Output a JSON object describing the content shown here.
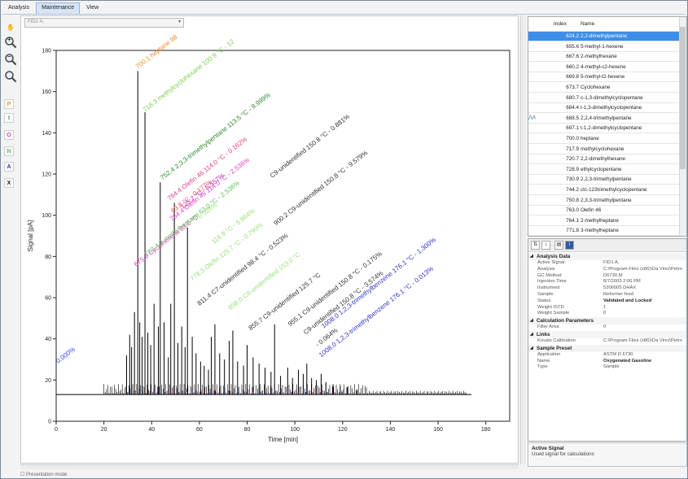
{
  "tabs": [
    {
      "label": "Analysis",
      "active": false
    },
    {
      "label": "Maintenance",
      "active": true
    },
    {
      "label": "View",
      "active": false
    }
  ],
  "toolbar": {
    "tools": [
      {
        "name": "pan-hand-icon",
        "glyph": "✋",
        "color": "#e8a020"
      },
      {
        "name": "zoom-in-icon",
        "glyph": "+",
        "color": "#333"
      },
      {
        "name": "zoom-out-icon",
        "glyph": "−",
        "color": "#333"
      },
      {
        "name": "zoom-reset-icon",
        "glyph": "",
        "color": "#333"
      },
      {
        "name": "paraffins-filter-icon",
        "glyph": "P",
        "color": "#e8a020"
      },
      {
        "name": "isoparaffins-filter-icon",
        "glyph": "I",
        "color": "#3a9a3a"
      },
      {
        "name": "olefins-filter-icon",
        "glyph": "O",
        "color": "#e040c0"
      },
      {
        "name": "naphthenes-filter-icon",
        "glyph": "N",
        "color": "#60c060"
      },
      {
        "name": "aromatics-filter-icon",
        "glyph": "A",
        "color": "#2a3ad0"
      },
      {
        "name": "unknowns-filter-icon",
        "glyph": "X",
        "color": "#222"
      }
    ]
  },
  "signal_select": {
    "value": "FID1 A,"
  },
  "bottom_text": "Presentation mode",
  "chart_data": {
    "type": "line",
    "xlabel": "Time [min]",
    "ylabel": "Signal [pA]",
    "xlim": [
      0,
      190
    ],
    "ylim": [
      0,
      180
    ],
    "xticks": [
      0,
      20,
      40,
      60,
      80,
      100,
      120,
      140,
      160,
      180
    ],
    "yticks": [
      0,
      20,
      40,
      60,
      80,
      100,
      120,
      140,
      160,
      180
    ],
    "baseline": 13,
    "trace_end_x": 174,
    "peaks": [
      {
        "x": 29.5,
        "h": 32
      },
      {
        "x": 30.8,
        "h": 42
      },
      {
        "x": 31.6,
        "h": 36
      },
      {
        "x": 32.8,
        "h": 53
      },
      {
        "x": 34.2,
        "h": 170
      },
      {
        "x": 35.0,
        "h": 48
      },
      {
        "x": 36.0,
        "h": 41
      },
      {
        "x": 37.2,
        "h": 150
      },
      {
        "x": 38.4,
        "h": 43
      },
      {
        "x": 39.6,
        "h": 37
      },
      {
        "x": 41.0,
        "h": 57
      },
      {
        "x": 42.8,
        "h": 46
      },
      {
        "x": 43.6,
        "h": 116
      },
      {
        "x": 45.2,
        "h": 48
      },
      {
        "x": 47.0,
        "h": 31
      },
      {
        "x": 48.0,
        "h": 57
      },
      {
        "x": 49.5,
        "h": 106
      },
      {
        "x": 51.0,
        "h": 38
      },
      {
        "x": 52.6,
        "h": 46
      },
      {
        "x": 54.0,
        "h": 36
      },
      {
        "x": 55.0,
        "h": 94
      },
      {
        "x": 57.0,
        "h": 41
      },
      {
        "x": 58.6,
        "h": 33
      },
      {
        "x": 60.5,
        "h": 29
      },
      {
        "x": 62.0,
        "h": 27
      },
      {
        "x": 63.8,
        "h": 25
      },
      {
        "x": 65.0,
        "h": 41
      },
      {
        "x": 66.5,
        "h": 47
      },
      {
        "x": 68.5,
        "h": 33
      },
      {
        "x": 70.5,
        "h": 30
      },
      {
        "x": 72.5,
        "h": 39
      },
      {
        "x": 74.0,
        "h": 44
      },
      {
        "x": 76.0,
        "h": 29
      },
      {
        "x": 78.5,
        "h": 27
      },
      {
        "x": 80.0,
        "h": 37
      },
      {
        "x": 82.5,
        "h": 31
      },
      {
        "x": 85.0,
        "h": 28
      },
      {
        "x": 87.5,
        "h": 26
      },
      {
        "x": 90.0,
        "h": 24
      },
      {
        "x": 91.5,
        "h": 47
      },
      {
        "x": 94.0,
        "h": 22
      },
      {
        "x": 97.0,
        "h": 26
      },
      {
        "x": 99.0,
        "h": 21
      },
      {
        "x": 101.5,
        "h": 25
      },
      {
        "x": 103.5,
        "h": 23
      },
      {
        "x": 105.0,
        "h": 28
      },
      {
        "x": 107.0,
        "h": 21
      },
      {
        "x": 109.0,
        "h": 20
      },
      {
        "x": 111.0,
        "h": 23
      },
      {
        "x": 113.0,
        "h": 19
      },
      {
        "x": 116.0,
        "h": 18
      },
      {
        "x": 119.0,
        "h": 17
      },
      {
        "x": 122.0,
        "h": 16.5
      },
      {
        "x": 126.0,
        "h": 15.5
      }
    ],
    "annotations": [
      {
        "x": 34.2,
        "y": 171,
        "text": "700.1 heptane 98",
        "color": "#f08a20"
      },
      {
        "x": 37.2,
        "y": 150,
        "text": "718.3 methylcyclohexane 100.9 °C - 12",
        "color": "#7ad04a"
      },
      {
        "x": 44.5,
        "y": 117,
        "text": "752.4 2,3,3-trimethylpentane 113.5 °C - 9.999%",
        "color": "#2a8a2a"
      },
      {
        "x": 47.5,
        "y": 107,
        "text": "764.4 Olefin 46 114.0 °C - 0.162%",
        "color": "#e83a8a"
      },
      {
        "x": 49.0,
        "y": 101,
        "text": "63.8 °C - 0.177%",
        "color": "#ff5050"
      },
      {
        "x": 53.0,
        "y": 103,
        "text": "125.7 °C - 6.557%",
        "color": "#c030c0"
      },
      {
        "x": 33.5,
        "y": 75,
        "text": "675.8 Cyclohexene 83.0 °C",
        "color": "#e040c0"
      },
      {
        "x": 48.5,
        "y": 97,
        "text": "764.4 Olefin 46 114.0 °C - 2.536%",
        "color": "#e040c0"
      },
      {
        "x": 59.0,
        "y": 97,
        "text": "- 0.026%",
        "color": "#9ae07a"
      },
      {
        "x": 66.0,
        "y": 86,
        "text": "116.9 °C - 5.864%",
        "color": "#9ae07a"
      },
      {
        "x": 90.5,
        "y": 118,
        "text": "C9-unidentified 150.8 °C - 0.881%",
        "color": "#333333"
      },
      {
        "x": 92.0,
        "y": 95,
        "text": "900.2 C9-unidentified 150.8 °C - 9.579%",
        "color": "#333333"
      },
      {
        "x": 38.0,
        "y": 80,
        "text": "763.4 2-methylheptane 63.0 °C - 2.536%",
        "color": "#60c060"
      },
      {
        "x": 57.0,
        "y": 68,
        "text": "778.3 Olefin 125.7 °C - 0.790%",
        "color": "#9ae07a"
      },
      {
        "x": 60.0,
        "y": 56,
        "text": "811.4 C7-unidentified 98.4 °C - 0.523%",
        "color": "#333333"
      },
      {
        "x": 73.0,
        "y": 54,
        "text": "898.0 C9-unidentified 153.0 °C",
        "color": "#9ae07a"
      },
      {
        "x": 81.5,
        "y": 44,
        "text": "855.7 C9-unidentified 125.7 °C",
        "color": "#333333"
      },
      {
        "x": 98.0,
        "y": 46,
        "text": "955.1 C9-unidentified 150.8 °C - 0.175%",
        "color": "#333333"
      },
      {
        "x": 104.5,
        "y": 42,
        "text": "C9-unidentified 150.8 °C - 3.574%",
        "color": "#333333"
      },
      {
        "x": 109.5,
        "y": 36,
        "text": "- 0.064%",
        "color": "#333333"
      },
      {
        "x": 112.0,
        "y": 45,
        "text": "1008.0 1,2,3-trimethylbenzene 176.1 °C - 1.300%",
        "color": "#3030d0"
      },
      {
        "x": 111.0,
        "y": 31,
        "text": "1008.0 1,2,3-trimethylbenzene 176.1 °C - 0.013%",
        "color": "#3030d0"
      },
      {
        "x": 0.8,
        "y": 28,
        "text": "0.000%",
        "color": "#4040ff"
      }
    ],
    "colors": {
      "trace": "#000000",
      "axis": "#222222",
      "aromatic_dots": "#3a4ae0",
      "olefin_dots": "#e040c0"
    }
  },
  "component_list": {
    "headers": {
      "index": "Index",
      "name": "Name"
    },
    "selected_index": 0,
    "rows": [
      {
        "index": "624.2",
        "name": "2,2-dimethylpentane"
      },
      {
        "index": "655.6",
        "name": "5-methyl-1-hexene"
      },
      {
        "index": "667.6",
        "name": "2-methylhexane"
      },
      {
        "index": "660.2",
        "name": "4-methyl-c2-hexene"
      },
      {
        "index": "669.8",
        "name": "5-methyl-t2-hexene"
      },
      {
        "index": "673.7",
        "name": "Cyclohexane"
      },
      {
        "index": "680.7",
        "name": "c-1,3-dimethylcyclopentane"
      },
      {
        "index": "684.4",
        "name": "t-1,3-dimethylcyclopentane"
      },
      {
        "index": "688.5",
        "name": "2,2,4-trimethylpentane"
      },
      {
        "index": "697.1",
        "name": "t-1,2-dimethylcyclopentane"
      },
      {
        "index": "700.0",
        "name": "heptane"
      },
      {
        "index": "717.9",
        "name": "methylcyclohexane"
      },
      {
        "index": "720.7",
        "name": "2,2-dimethylhexane"
      },
      {
        "index": "728.9",
        "name": "ethylcyclopentane"
      },
      {
        "index": "730.9",
        "name": "2,2,3-trimethylpentane"
      },
      {
        "index": "744.2",
        "name": "ctc-123trimethylcyclopentane"
      },
      {
        "index": "750.8",
        "name": "2,3,3-trimethylpentane"
      },
      {
        "index": "763.0",
        "name": "Olefin 46"
      },
      {
        "index": "764.1",
        "name": "2-methylheptane"
      },
      {
        "index": "771.8",
        "name": "3-methylheptane"
      }
    ],
    "marker_row": 8,
    "marker_text": "⋀A"
  },
  "properties": {
    "categories": [
      {
        "label": "Analysis Data",
        "rows": [
          {
            "k": "Active Signal",
            "v": "FID1 A,",
            "bold": false
          },
          {
            "k": "Analysis",
            "v": "C:\\Program Files (x86)\\Da Vinci\\Petro",
            "bold": false
          },
          {
            "k": "GC Method",
            "v": "D6730.M",
            "bold": false
          },
          {
            "k": "Injection Time",
            "v": "8/7/2003 2:06 PM",
            "bold": false
          },
          {
            "k": "Instrument",
            "v": "5306005 DHAX",
            "bold": false
          },
          {
            "k": "Sample",
            "v": "Reformer feed",
            "bold": false
          },
          {
            "k": "Status",
            "v": "Validated and Locked",
            "bold": true
          },
          {
            "k": "Weight ISTD",
            "v": "1",
            "bold": false
          },
          {
            "k": "Weight Sample",
            "v": "0",
            "bold": false
          }
        ]
      },
      {
        "label": "Calculation Parameters",
        "rows": [
          {
            "k": "Filter Area",
            "v": "0",
            "bold": false
          }
        ]
      },
      {
        "label": "Links",
        "rows": [
          {
            "k": "Kovats Calibration",
            "v": "C:\\Program Files (x86)\\Da Vinci\\Petro",
            "bold": false
          }
        ]
      },
      {
        "label": "Sample Preset",
        "rows": [
          {
            "k": "Application",
            "v": "ASTM D 6730",
            "bold": false
          },
          {
            "k": "Name",
            "v": "Oxygenated Gasoline",
            "bold": true
          },
          {
            "k": "Type",
            "v": "Sample",
            "bold": false
          }
        ]
      }
    ],
    "description": {
      "title": "Active Signal",
      "text": "Used signal for calculations"
    }
  }
}
